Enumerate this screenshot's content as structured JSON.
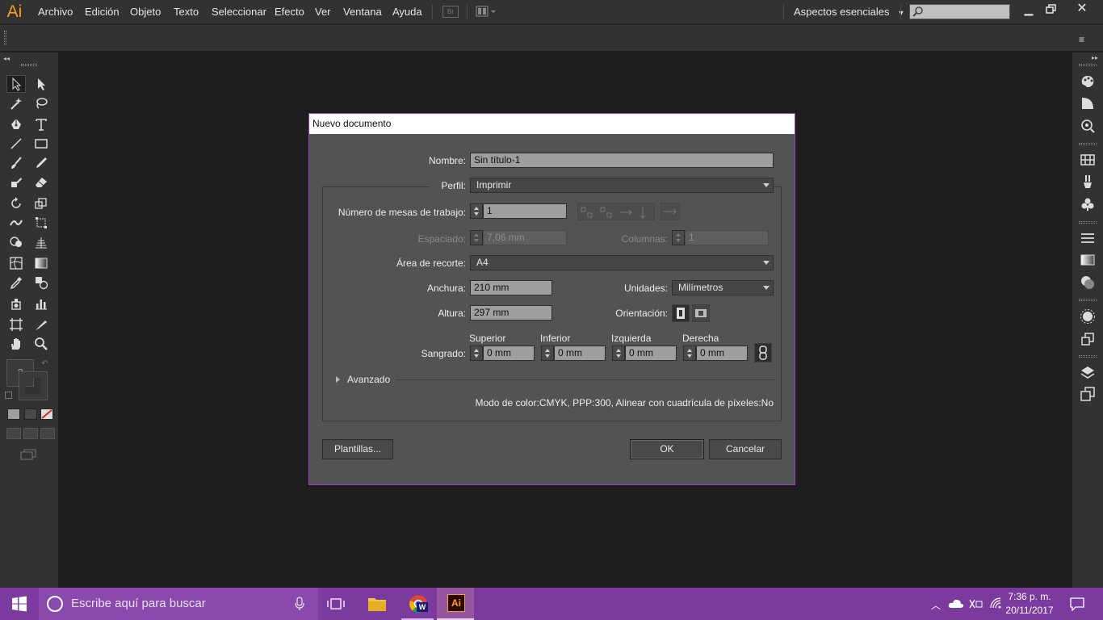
{
  "app": {
    "logo": "Ai"
  },
  "menu": [
    "Archivo",
    "Edición",
    "Objeto",
    "Texto",
    "Seleccionar",
    "Efecto",
    "Ver",
    "Ventana",
    "Ayuda"
  ],
  "toolbar_top": {
    "br_label": "Br",
    "workspace": "Aspectos esenciales"
  },
  "dialog": {
    "title": "Nuevo documento",
    "nombre_label": "Nombre:",
    "nombre_value": "Sin título-1",
    "perfil_label": "Perfil:",
    "perfil_value": "Imprimir",
    "mesas_label": "Número de mesas de trabajo:",
    "mesas_value": "1",
    "espaciado_label": "Espaciado:",
    "espaciado_value": "7,06 mm",
    "columnas_label": "Columnas:",
    "columnas_value": "1",
    "area_label": "Área de recorte:",
    "area_value": "A4",
    "anchura_label": "Anchura:",
    "anchura_value": "210 mm",
    "unidades_label": "Unidades:",
    "unidades_value": "Milímetros",
    "altura_label": "Altura:",
    "altura_value": "297 mm",
    "orientacion_label": "Orientación:",
    "sangrado_label": "Sangrado:",
    "superior_label": "Superior",
    "inferior_label": "Inferior",
    "izquierda_label": "Izquierda",
    "derecha_label": "Derecha",
    "superior_value": "0 mm",
    "inferior_value": "0 mm",
    "izquierda_value": "0 mm",
    "derecha_value": "0 mm",
    "avanzado_label": "Avanzado",
    "info": "Modo de color:CMYK, PPP:300, Alinear con cuadrícula de píxeles:No",
    "plantillas_label": "Plantillas...",
    "ok_label": "OK",
    "cancel_label": "Cancelar"
  },
  "toolbox": {
    "help_glyph": "?"
  },
  "taskbar": {
    "search_placeholder": "Escribe aquí para buscar",
    "time": "7:36 p. m.",
    "date": "20/11/2017"
  },
  "colors": {
    "accent_purple": "#7a3a9e",
    "ai_orange": "#f7a21b",
    "dialog_border": "#a03cbf"
  }
}
